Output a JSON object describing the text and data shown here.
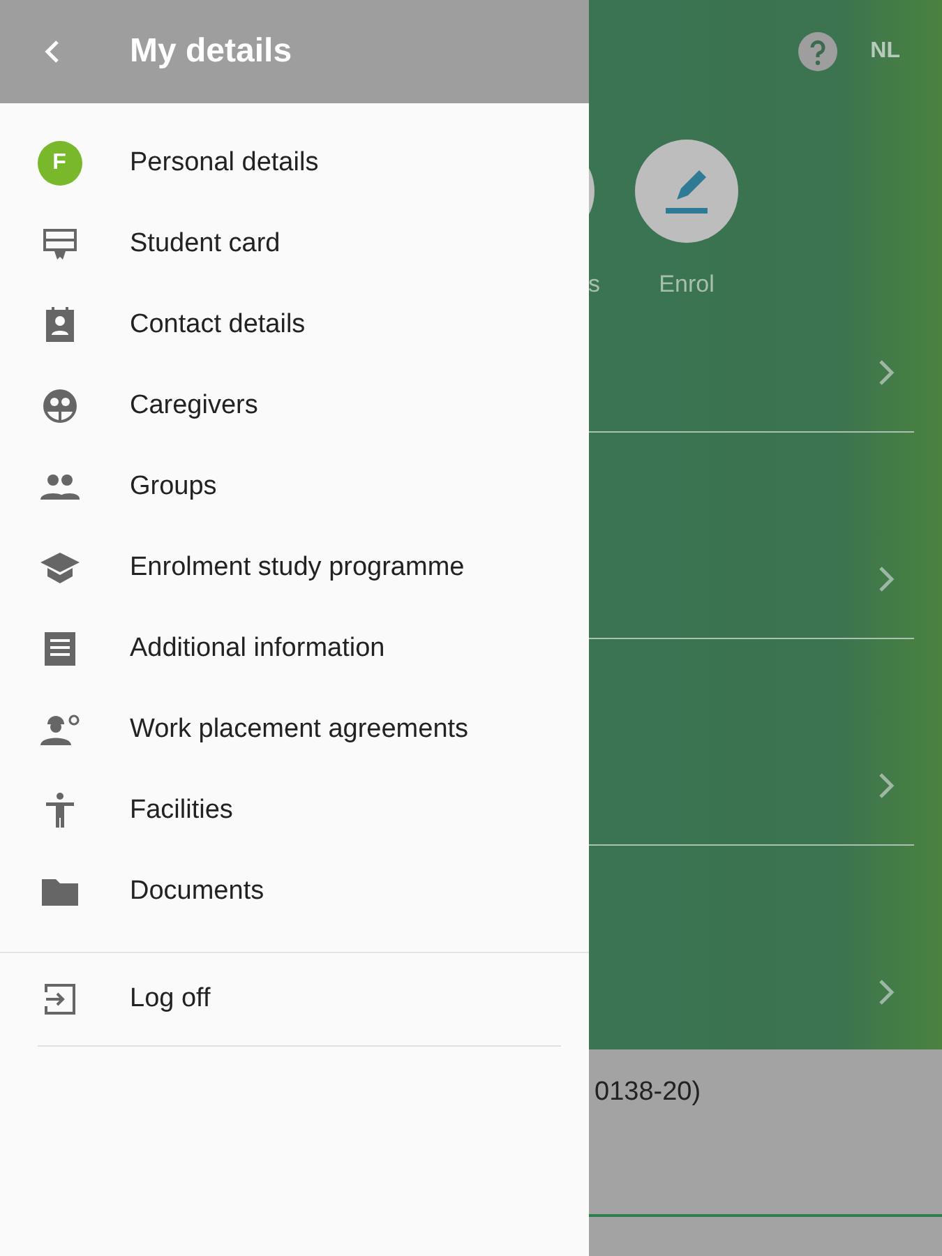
{
  "drawer": {
    "title": "My details",
    "items": [
      {
        "kind": "avatar",
        "avatar": "F",
        "label": "Personal details"
      },
      {
        "kind": "card",
        "label": "Student card"
      },
      {
        "kind": "contact",
        "label": "Contact details"
      },
      {
        "kind": "caregivers",
        "label": "Caregivers"
      },
      {
        "kind": "groups",
        "label": "Groups"
      },
      {
        "kind": "school",
        "label": "Enrolment study programme"
      },
      {
        "kind": "info",
        "label": "Additional information"
      },
      {
        "kind": "work",
        "label": "Work placement agreements"
      },
      {
        "kind": "facilities",
        "label": "Facilities"
      },
      {
        "kind": "folder",
        "label": "Documents"
      }
    ],
    "footer_items": [
      {
        "kind": "logoff",
        "label": "Log off"
      }
    ]
  },
  "background": {
    "language": "NL",
    "shortcuts": [
      {
        "kind": "cut",
        "label": "s"
      },
      {
        "kind": "edit",
        "label": "Enrol"
      }
    ],
    "rows": [
      {
        "chevron": true
      },
      {
        "chevron": true
      },
      {
        "chevron": true
      },
      {
        "chevron": true
      }
    ],
    "panel_text": "0138-20)"
  }
}
